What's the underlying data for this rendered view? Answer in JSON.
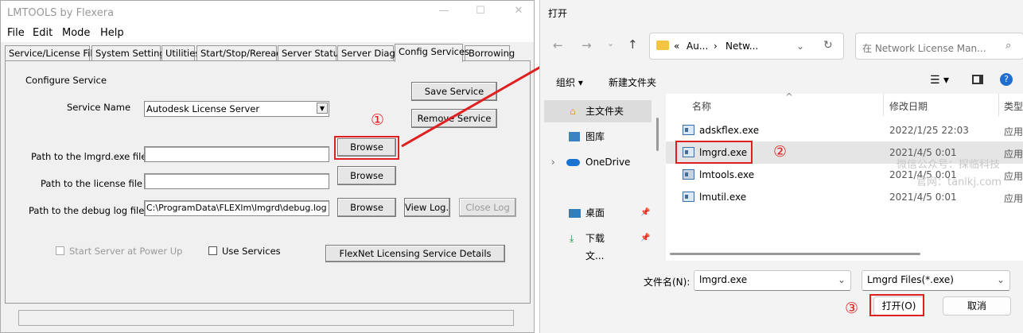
{
  "lmtools": {
    "title": "LMTOOLS by Flexera",
    "window_controls": {
      "minimize": "—",
      "maximize": "☐",
      "close": "✕"
    },
    "menu": [
      "File",
      "Edit",
      "Mode",
      "Help"
    ],
    "tabs": [
      "Service/License File",
      "System Settings",
      "Utilities",
      "Start/Stop/Reread",
      "Server Status",
      "Server Diags",
      "Config Services",
      "Borrowing"
    ],
    "active_tab": "Config Services",
    "configure_service_label": "Configure Service",
    "service_name_label": "Service Name",
    "service_name_value": "Autodesk License Server",
    "lmgrd_label": "Path to the lmgrd.exe file",
    "lmgrd_value": "",
    "license_label": "Path to the license file",
    "license_value": "",
    "debuglog_label": "Path to the debug log file",
    "debuglog_value": "C:\\ProgramData\\FLEXlm\\lmgrd\\debug.log",
    "save_service": "Save Service",
    "remove_service": "Remove Service",
    "browse": "Browse",
    "view_log": "View Log...",
    "close_log": "Close Log",
    "start_at_powerup": "Start Server at Power Up",
    "use_services": "Use Services",
    "flexnet_details": "FlexNet Licensing Service Details"
  },
  "annotations": {
    "step1": "①",
    "step2": "②",
    "step3": "③",
    "color": "#e02020"
  },
  "dialog": {
    "title": "打开",
    "address": {
      "prefix": "«",
      "part1": "Au...",
      "sep": "›",
      "part2": "Netw..."
    },
    "search_placeholder": "在 Network License Man...",
    "organize": "组织 ▾",
    "new_folder": "新建文件夹",
    "sidebar": [
      "主文件夹",
      "图库",
      "OneDrive",
      "桌面",
      "下载",
      "文..."
    ],
    "columns": {
      "name": "名称",
      "date": "修改日期",
      "type": "类型"
    },
    "files": [
      {
        "name": "adskflex.exe",
        "date": "2022/1/25 22:03",
        "type": "应用"
      },
      {
        "name": "lmgrd.exe",
        "date": "2021/4/5 0:01",
        "type": "应用"
      },
      {
        "name": "lmtools.exe",
        "date": "2021/4/5 0:01",
        "type": "应用"
      },
      {
        "name": "lmutil.exe",
        "date": "2021/4/5 0:01",
        "type": "应用"
      }
    ],
    "filename_label": "文件名(N):",
    "filename_value": "lmgrd.exe",
    "filetype_value": "Lmgrd Files(*.exe)",
    "open_button": "打开(O)",
    "cancel_button": "取消",
    "watermark_line1": "微信公众号：探临科技",
    "watermark_line2": "官网：tanlkj.com"
  }
}
